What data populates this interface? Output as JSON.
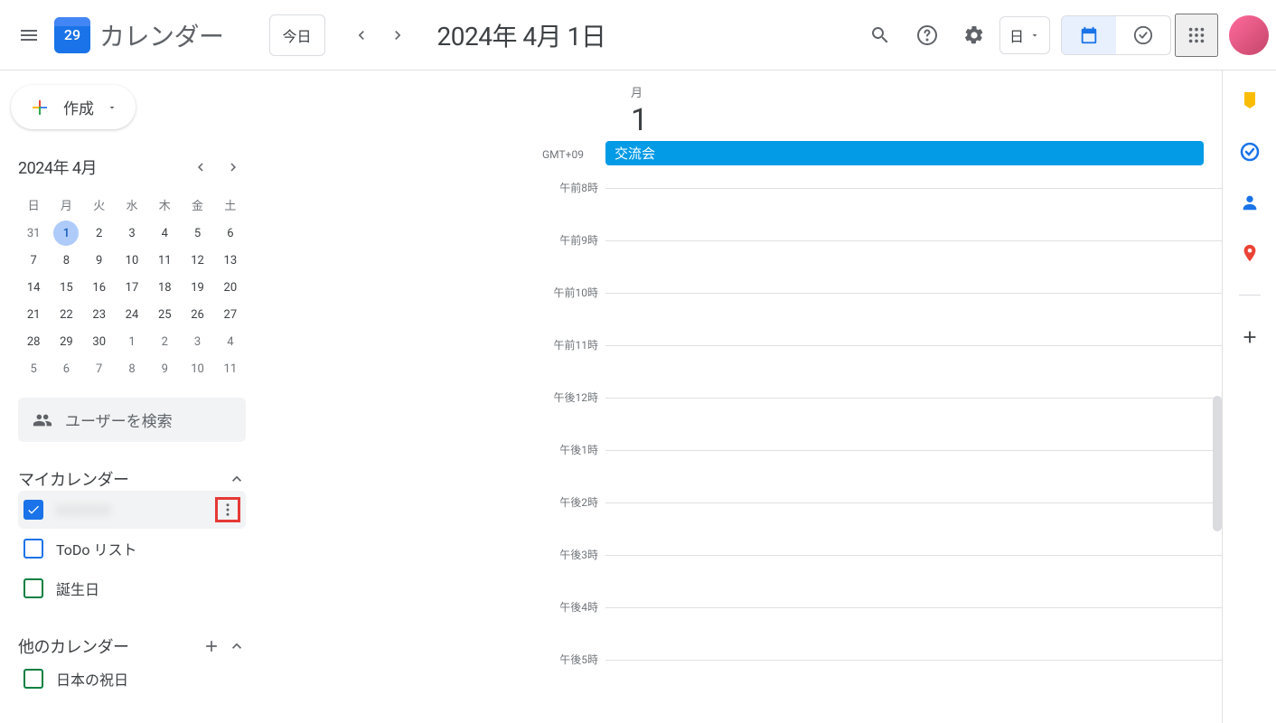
{
  "header": {
    "app_name": "カレンダー",
    "logo_day": "29",
    "today_button": "今日",
    "date_title": "2024年 4月 1日",
    "view_label": "日"
  },
  "sidebar": {
    "create_label": "作成",
    "mini_month_label": "2024年 4月",
    "dow": [
      "日",
      "月",
      "火",
      "水",
      "木",
      "金",
      "土"
    ],
    "weeks": [
      [
        "31",
        "1",
        "2",
        "3",
        "4",
        "5",
        "6"
      ],
      [
        "7",
        "8",
        "9",
        "10",
        "11",
        "12",
        "13"
      ],
      [
        "14",
        "15",
        "16",
        "17",
        "18",
        "19",
        "20"
      ],
      [
        "21",
        "22",
        "23",
        "24",
        "25",
        "26",
        "27"
      ],
      [
        "28",
        "29",
        "30",
        "1",
        "2",
        "3",
        "4"
      ],
      [
        "5",
        "6",
        "7",
        "8",
        "9",
        "10",
        "11"
      ]
    ],
    "selected_day": "1",
    "search_users_placeholder": "ユーザーを検索",
    "my_calendars_label": "マイカレンダー",
    "my_calendars": [
      {
        "label": "XXXXXX",
        "color": "checked-blue",
        "active": true,
        "blur": true,
        "highlight_more": true
      },
      {
        "label": "ToDo リスト",
        "color": "blue"
      },
      {
        "label": "誕生日",
        "color": "green"
      }
    ],
    "other_calendars_label": "他のカレンダー",
    "other_calendars": [
      {
        "label": "日本の祝日",
        "color": "dgreen"
      }
    ]
  },
  "main": {
    "dow_label": "月",
    "day_num": "1",
    "timezone": "GMT+09",
    "event_title": "交流会",
    "time_labels": [
      "午前8時",
      "午前9時",
      "午前10時",
      "午前11時",
      "午後12時",
      "午後1時",
      "午後2時",
      "午後3時",
      "午後4時",
      "午後5時"
    ]
  }
}
